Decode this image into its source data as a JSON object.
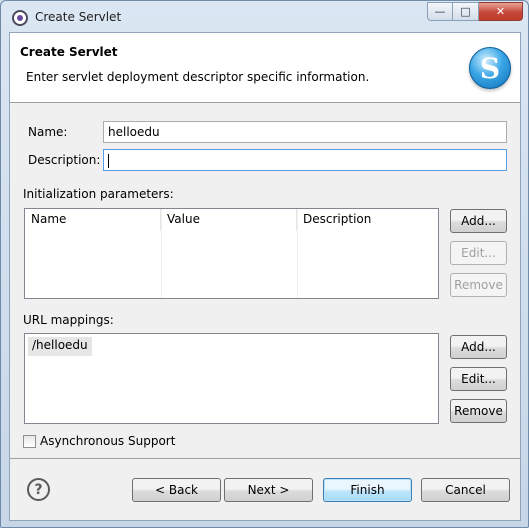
{
  "window": {
    "title": "Create Servlet",
    "controls": {
      "minimize": "—",
      "maximize": "□",
      "close": "✕"
    }
  },
  "banner": {
    "title": "Create Servlet",
    "description": "Enter servlet deployment descriptor specific information.",
    "logo_letter": "S"
  },
  "form": {
    "name_label": "Name:",
    "name_value": "helloedu",
    "description_label": "Description:",
    "description_value": ""
  },
  "init_params": {
    "label": "Initialization parameters:",
    "columns": [
      "Name",
      "Value",
      "Description"
    ],
    "rows": [],
    "buttons": {
      "add": "Add...",
      "edit": "Edit...",
      "remove": "Remove"
    }
  },
  "url_mappings": {
    "label": "URL mappings:",
    "items": [
      "/helloedu"
    ],
    "buttons": {
      "add": "Add...",
      "edit": "Edit...",
      "remove": "Remove"
    }
  },
  "async_support": {
    "label": "Asynchronous Support",
    "checked": false
  },
  "footer": {
    "back": "< Back",
    "next": "Next >",
    "finish": "Finish",
    "cancel": "Cancel",
    "help_glyph": "?"
  }
}
